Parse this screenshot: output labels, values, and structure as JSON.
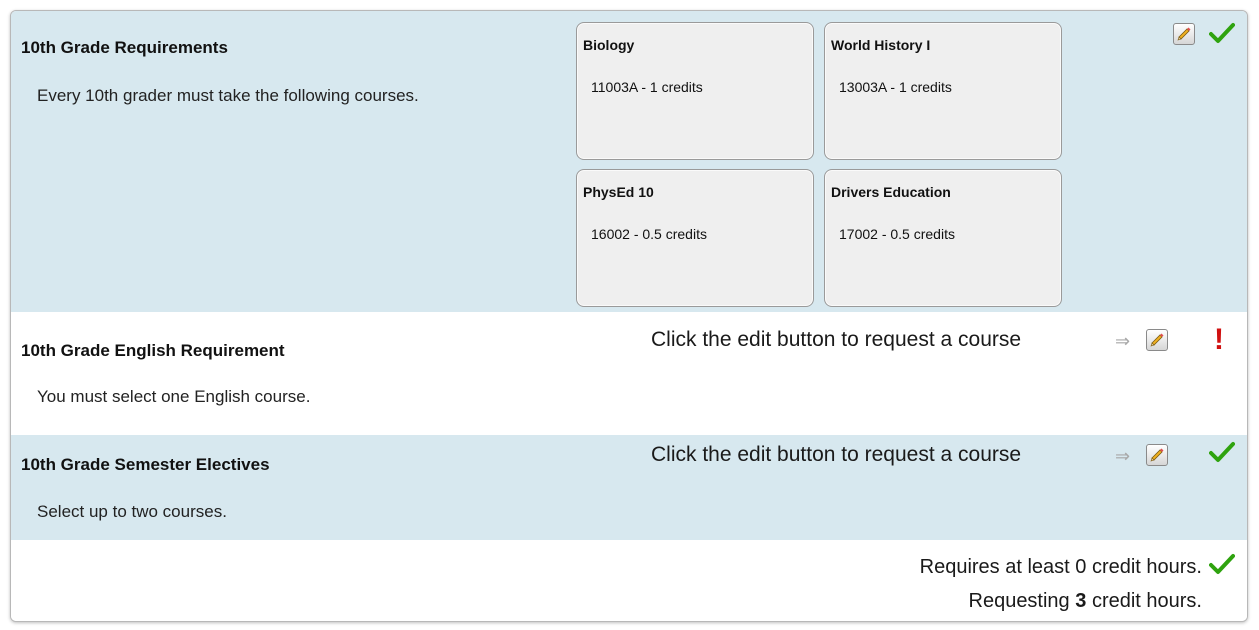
{
  "sections": [
    {
      "title": "10th Grade Requirements",
      "description": "Every 10th grader must take the following courses.",
      "status": "complete",
      "courses": [
        {
          "name": "Biology",
          "code_credits": "11003A - 1 credits"
        },
        {
          "name": "World History I",
          "code_credits": "13003A - 1 credits"
        },
        {
          "name": "PhysEd 10",
          "code_credits": "16002 - 0.5 credits"
        },
        {
          "name": "Drivers Education",
          "code_credits": "17002 - 0.5 credits"
        }
      ]
    },
    {
      "title": "10th Grade English Requirement",
      "description": "You must select one English course.",
      "hint": "Click the edit button to request a course",
      "status": "incomplete"
    },
    {
      "title": "10th Grade Semester Electives",
      "description": "Select up to two courses.",
      "hint": "Click the edit button to request a course",
      "status": "complete"
    }
  ],
  "summary": {
    "requires_text": "Requires at least 0 credit hours.",
    "requesting_prefix": "Requesting",
    "requesting_value": "3",
    "requesting_suffix": "credit hours."
  },
  "icons": {
    "arrow": "⇒",
    "alert": "!"
  },
  "colors": {
    "section_blue": "#d7e8ef",
    "check_green": "#2fa30f",
    "alert_red": "#d01010"
  }
}
